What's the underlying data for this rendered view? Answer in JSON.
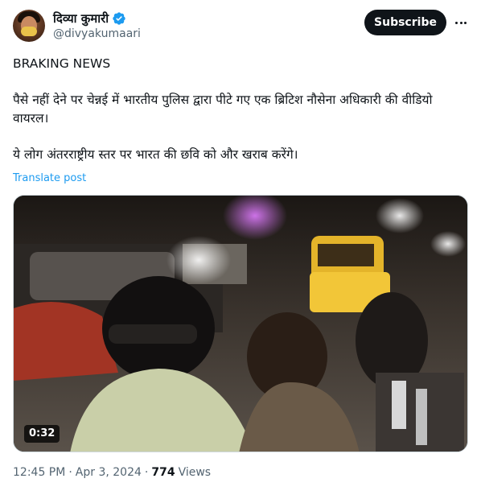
{
  "author": {
    "display_name": "दिव्या कुमारी",
    "handle": "@divyakumaari",
    "verified": true
  },
  "actions": {
    "subscribe_label": "Subscribe"
  },
  "tweet": {
    "line1": "BRAKING NEWS",
    "line2": "पैसे नहीं देने पर चेन्नई में भारतीय पुलिस द्वारा पीटे गए एक ब्रिटिश नौसेना अधिकारी की वीडियो वायरल।",
    "line3": "ये लोग अंतरराष्ट्रीय स्तर पर भारत की छवि को और खराब करेंगे।",
    "translate_label": "Translate post"
  },
  "media": {
    "duration": "0:32"
  },
  "meta": {
    "time": "12:45 PM",
    "date": "Apr 3, 2024",
    "views_count": "774",
    "views_label": "Views",
    "separator": "·"
  },
  "colors": {
    "accent": "#1d9bf0",
    "text_primary": "#0f1419",
    "text_secondary": "#536471"
  }
}
